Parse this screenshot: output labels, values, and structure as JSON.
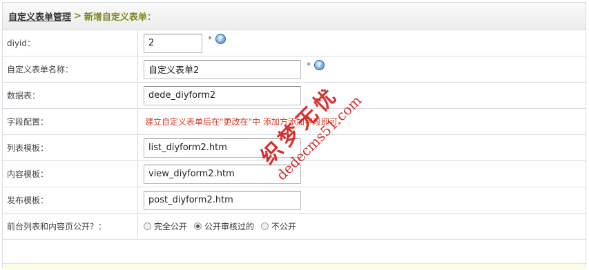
{
  "breadcrumb": {
    "link": "自定义表单管理",
    "separator": ">",
    "current": "新增自定义表单："
  },
  "rows": [
    {
      "label": "diyid：",
      "value": "2",
      "required": "*",
      "help": "?"
    },
    {
      "label": "自定义表单名称：",
      "value": "自定义表单2",
      "required": "*",
      "help": "?"
    },
    {
      "label": "数据表：",
      "value": "dede_diyform2"
    },
    {
      "label": "字段配置：",
      "notice": "建立自定义表单后在\"更改在\"中 添加方添加字段即可。"
    },
    {
      "label": "列表模板：",
      "value": "list_diyform2.htm"
    },
    {
      "label": "内容模板：",
      "value": "view_diyform2.htm"
    },
    {
      "label": "发布模板：",
      "value": "post_diyform2.htm"
    },
    {
      "label": "前台列表和内容页公开？：",
      "options": [
        "完全公开",
        "公开审核过的",
        "不公开"
      ],
      "selected": "公开审核过的"
    }
  ],
  "watermark": {
    "cn": "织梦无忧",
    "en": "dedecms51.com"
  },
  "colors": {
    "accent": "#7e8a1b",
    "notice": "#d53b2b",
    "border": "#d7dde2"
  }
}
